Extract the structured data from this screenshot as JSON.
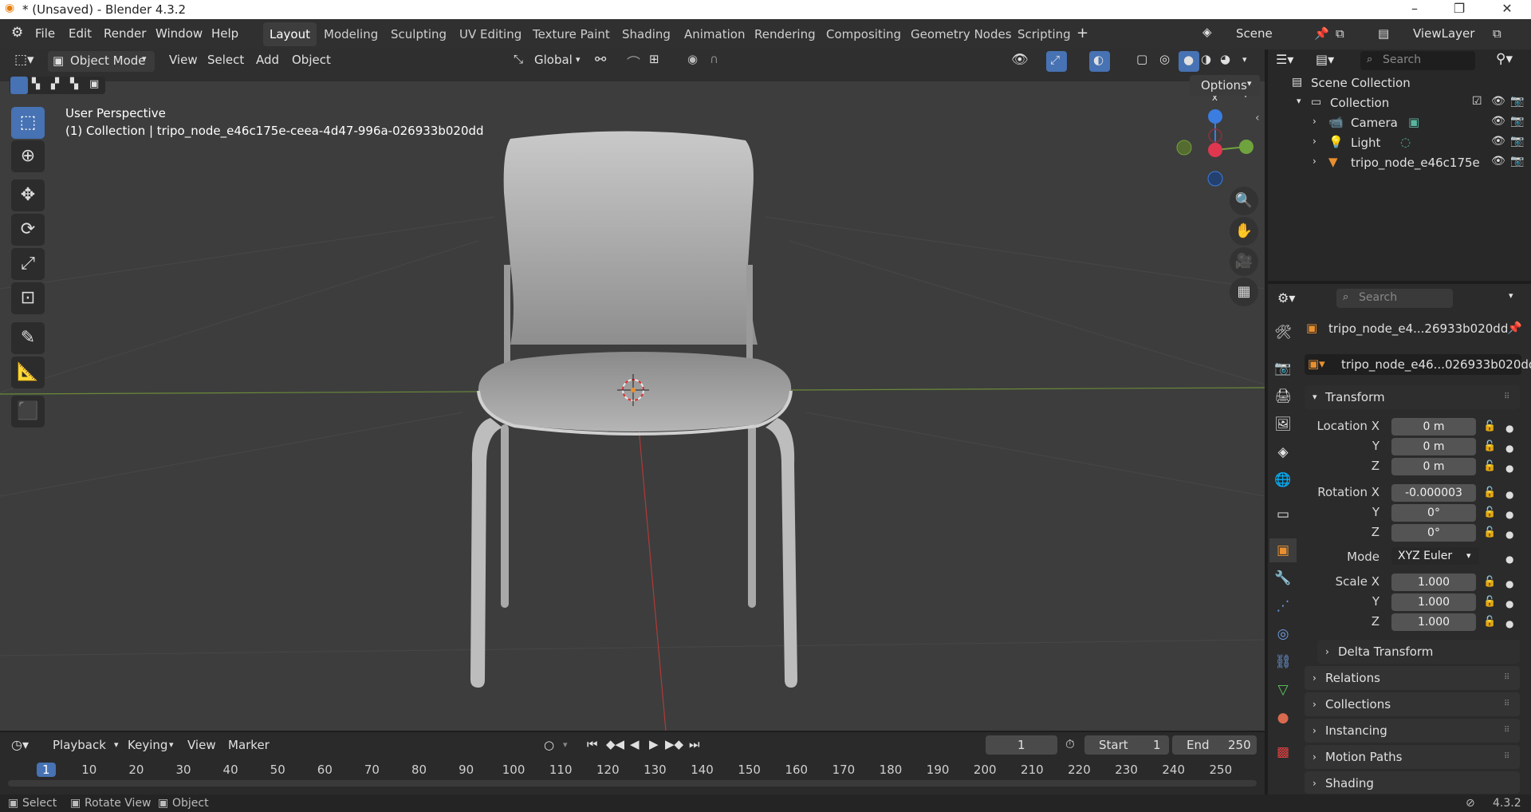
{
  "window": {
    "title": "* (Unsaved) - Blender 4.3.2"
  },
  "menu": [
    "File",
    "Edit",
    "Render",
    "Window",
    "Help"
  ],
  "workspaces": [
    "Layout",
    "Modeling",
    "Sculpting",
    "UV Editing",
    "Texture Paint",
    "Shading",
    "Animation",
    "Rendering",
    "Compositing",
    "Geometry Nodes",
    "Scripting"
  ],
  "active_workspace": "Layout",
  "scene": {
    "name": "Scene",
    "view_layer": "ViewLayer"
  },
  "viewport": {
    "mode": "Object Mode",
    "menus": [
      "View",
      "Select",
      "Add",
      "Object"
    ],
    "orientation": "Global",
    "options_label": "Options",
    "perspective": "User Perspective",
    "collection_info": "(1) Collection | tripo_node_e46c175e-ceea-4d47-996a-026933b020dd",
    "gizmo": {
      "x": "X",
      "y": "Y",
      "z": "Z"
    }
  },
  "outliner": {
    "search_placeholder": "Search",
    "root": "Scene Collection",
    "collection": "Collection",
    "items": [
      "Camera",
      "Light",
      "tripo_node_e46c175e"
    ]
  },
  "properties": {
    "search_placeholder": "Search",
    "object_name": "tripo_node_e4...26933b020dd",
    "data_name": "tripo_node_e46...026933b020dd",
    "transform_label": "Transform",
    "location": {
      "label": "Location X",
      "x": "0 m",
      "y": "0 m",
      "z": "0 m"
    },
    "rotation": {
      "label": "Rotation X",
      "x": "-0.000003",
      "y": "0°",
      "z": "0°"
    },
    "mode": {
      "label": "Mode",
      "value": "XYZ Euler"
    },
    "scale": {
      "label": "Scale X",
      "x": "1.000",
      "y": "1.000",
      "z": "1.000"
    },
    "axis_y": "Y",
    "axis_z": "Z",
    "panels": [
      "Delta Transform",
      "Relations",
      "Collections",
      "Instancing",
      "Motion Paths",
      "Shading"
    ]
  },
  "timeline": {
    "menus": [
      "Playback",
      "Keying",
      "View",
      "Marker"
    ],
    "current_frame": "1",
    "start_label": "Start",
    "start": "1",
    "end_label": "End",
    "end": "250",
    "ticks": [
      "1",
      "10",
      "20",
      "30",
      "40",
      "50",
      "60",
      "70",
      "80",
      "90",
      "100",
      "110",
      "120",
      "130",
      "140",
      "150",
      "160",
      "170",
      "180",
      "190",
      "200",
      "210",
      "220",
      "230",
      "240",
      "250"
    ]
  },
  "status": {
    "items": [
      "Select",
      "Rotate View",
      "Object"
    ],
    "version": "4.3.2"
  },
  "colors": {
    "accent": "#4772b3",
    "x_axis": "#e0364f",
    "y_axis": "#6fa33d",
    "z_axis": "#3b7de0",
    "object_orange": "#e8902f"
  }
}
